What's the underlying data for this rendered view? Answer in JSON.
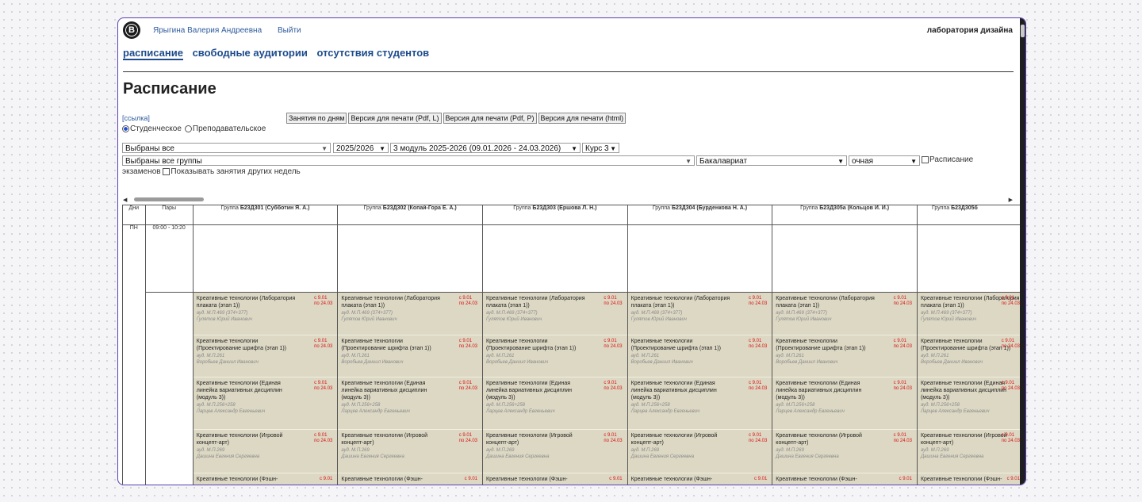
{
  "header": {
    "user_name": "Ярыгина Валерия Андреевна",
    "logout": "Выйти",
    "brand": "лаборатория дизайна",
    "logo_letter": "В"
  },
  "nav": {
    "schedule": "расписание",
    "free_rooms": "свободные аудитории",
    "absences": "отсутствия студентов"
  },
  "page_title": "Расписание",
  "link_label": "[ссылка]",
  "buttons": {
    "by_days": "Занятия по дням",
    "pdf_l": "Версия для печати (Pdf, L)",
    "pdf_p": "Версия для печати (Pdf, P)",
    "html": "Версия для печати (html)"
  },
  "radios": {
    "student": "Студенческое",
    "teacher": "Преподавательское"
  },
  "filters": {
    "faculties": "Выбраны все",
    "year": "2025/2026",
    "module": "3 модуль 2025-2026 (09.01.2026 - 24.03.2026)",
    "course": "Курс 3",
    "groups": "Выбраны все группы",
    "level": "Бакалавриат",
    "form": "очная"
  },
  "checks": {
    "exam_prefix": "Расписание",
    "exam_suffix": "экзаменов",
    "other_weeks": "Показывать занятия других недель"
  },
  "table": {
    "col_days": "Дни",
    "col_pairs": "Пары",
    "groups": [
      {
        "prefix": "Группа ",
        "code": "Б23Д301",
        "teacher": " (Субботин Я. А.)"
      },
      {
        "prefix": "Группа ",
        "code": "Б23Д302",
        "teacher": " (Копай-Гора Е. А.)"
      },
      {
        "prefix": "Группа ",
        "code": "Б23Д303",
        "teacher": " (Ершова Л. Н.)"
      },
      {
        "prefix": "Группа ",
        "code": "Б23Д304",
        "teacher": " (Бурденкова Н. А.)"
      },
      {
        "prefix": "Группа ",
        "code": "Б23Д305а",
        "teacher": " (Кольцов И. И.)"
      },
      {
        "prefix": "Группа ",
        "code": "Б23Д305б",
        "teacher": ""
      }
    ],
    "day": "ПН",
    "pair_time": "09:00 - 10:20",
    "lessons": [
      {
        "name": "Креативные технологии (Лаборатория плаката (этап 1))",
        "room": "ауд. М.П.469 (374+377)",
        "teacher": "Гулятов Юрий Иванович",
        "date_from": "с 9.01",
        "date_to": "по 24.03"
      },
      {
        "name": "Креативные технологии (Проектирование шрифта (этап 1))",
        "room": "ауд. М.П.261",
        "teacher": "Воробьев Даниил Иванович",
        "date_from": "с 9.01",
        "date_to": "по 24.03"
      },
      {
        "name": "Креативные технологии (Единая линейка вариативных дисциплин (модуль 3))",
        "room": "ауд. М.П.256+258",
        "teacher": "Ларцев Александр Евгеньевич",
        "date_from": "с 9.01",
        "date_to": "по 24.03"
      },
      {
        "name": "Креативные технологии (Игровой концепт-арт)",
        "room": "ауд. М.П.269",
        "teacher": "Дашина Евгения Сергеевна",
        "date_from": "с 9.01",
        "date_to": "по 24.03"
      },
      {
        "name": "Креативные технологии (Фэшн-",
        "room": "",
        "teacher": "",
        "date_from": "с 9.01",
        "date_to": ""
      }
    ]
  },
  "colors": {
    "accent": "#1d4b8c",
    "link": "#2d5a9e",
    "lesson_bg": "#dcd8c4",
    "date_red": "#dd1111",
    "frame": "#5b3fb3"
  }
}
